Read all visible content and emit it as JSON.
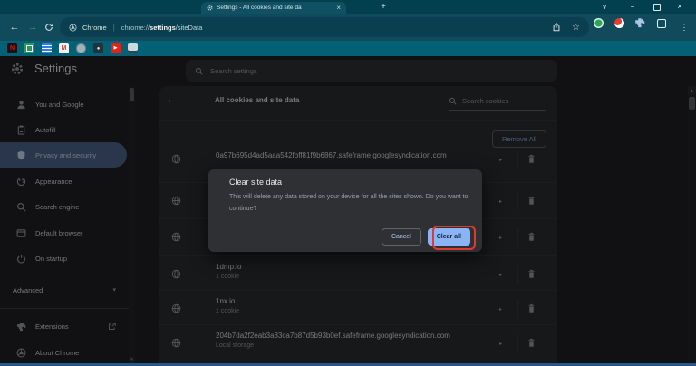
{
  "browser": {
    "tab": {
      "title": "Settings - All cookies and site da",
      "close_glyph": "×"
    },
    "new_tab_glyph": "+",
    "window_controls": {
      "chevron": "∨",
      "minimize": "−",
      "close": "×"
    },
    "nav": {
      "back_glyph": "←",
      "forward_glyph": "→"
    },
    "address_bar": {
      "engine_label": "Chrome",
      "separator": "|",
      "url_scheme": "chrome://",
      "url_bold": "settings",
      "url_rest": "/siteData",
      "star_glyph": "☆",
      "menu_glyph": "⋮"
    },
    "bookmarks": [
      {
        "name": "netflix",
        "glyph": "N",
        "bg": "#141414",
        "fg": "#e50914"
      },
      {
        "name": "google-sheets",
        "glyph": "",
        "bg": "#1e9e5a",
        "fg": "#ffffff"
      },
      {
        "name": "notes",
        "glyph": "",
        "bg": "#2f80ed",
        "fg": "#ffffff"
      },
      {
        "name": "gmail",
        "glyph": "M",
        "bg": "#f3f5f5",
        "fg": "#ea4335"
      },
      {
        "name": "globe",
        "glyph": "",
        "bg": "#9fb3ba",
        "fg": "#5b6b72"
      },
      {
        "name": "profile",
        "glyph": "",
        "bg": "#20323a",
        "fg": "#dde6e9"
      },
      {
        "name": "youtube",
        "glyph": "▶",
        "bg": "#e62117",
        "fg": "#ffffff"
      },
      {
        "name": "remote-desktop",
        "glyph": "",
        "bg": "#cfd9dd",
        "fg": "#30444d"
      }
    ],
    "theme_colors": {
      "titlebar": "#03404f",
      "toolbar": "#114b5b",
      "bookmarks_bar": "#046075"
    }
  },
  "settings": {
    "title": "Settings",
    "search_placeholder": "Search settings",
    "nav_items": [
      {
        "label": "You and Google"
      },
      {
        "label": "Autofill"
      },
      {
        "label": "Privacy and security",
        "selected": true
      },
      {
        "label": "Appearance"
      },
      {
        "label": "Search engine"
      },
      {
        "label": "Default browser"
      },
      {
        "label": "On startup"
      }
    ],
    "advanced_label": "Advanced",
    "advanced_caret": "▾",
    "footer_items": [
      {
        "label": "Extensions"
      },
      {
        "label": "About Chrome"
      }
    ],
    "selected_color": "#50668f"
  },
  "cookies_page": {
    "back_glyph": "←",
    "title": "All cookies and site data",
    "search_placeholder": "Search cookies",
    "remove_all_label": "Remove All",
    "row_chevron": "▸",
    "rows": [
      {
        "name": "0a97b695d4ad5aaa542fbff81f9b6867.safeframe.googlesyndication.com",
        "detail": ""
      },
      {
        "name": "",
        "detail": ""
      },
      {
        "name": "",
        "detail": ""
      },
      {
        "name": "1dmp.io",
        "detail": "1 cookie"
      },
      {
        "name": "1nx.io",
        "detail": "1 cookie"
      },
      {
        "name": "204b7da2f2eab3a33ca7b87d5b93b0ef.safeframe.googlesyndication.com",
        "detail": "Local storage"
      }
    ]
  },
  "dialog": {
    "title": "Clear site data",
    "body": "This will delete any data stored on your device for all the sites shown. Do you want to continue?",
    "cancel_label": "Cancel",
    "confirm_label": "Clear all",
    "annotation_color": "#e0392e"
  },
  "scrollbar_glyphs": {
    "up": "▴",
    "down": "▾"
  }
}
